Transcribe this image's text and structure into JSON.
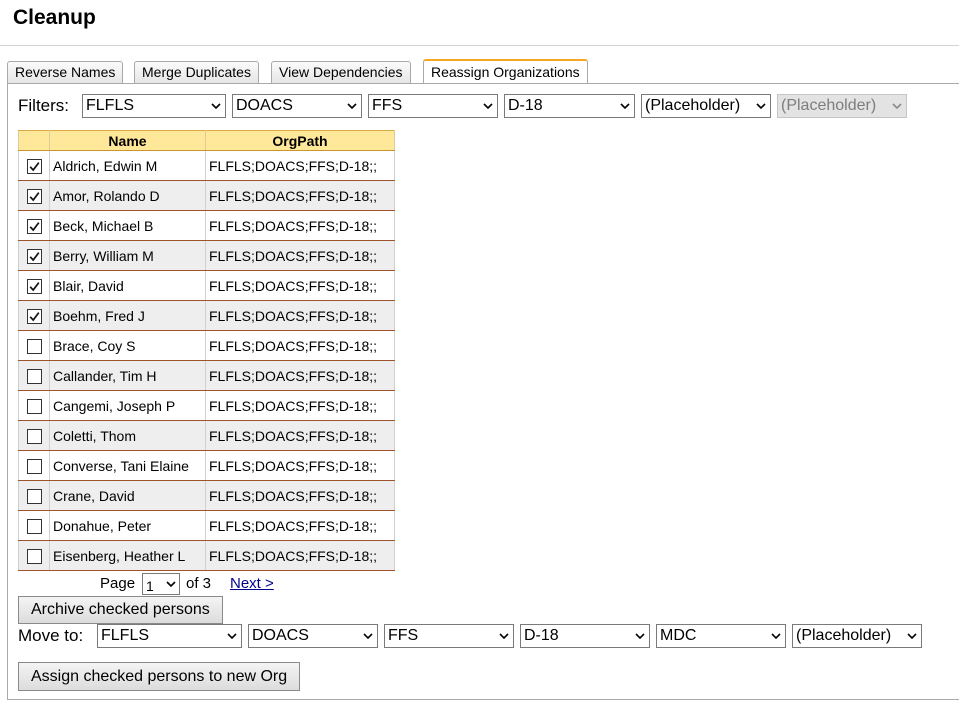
{
  "page": {
    "title": "Cleanup"
  },
  "tabs": [
    {
      "label": "Reverse Names"
    },
    {
      "label": "Merge Duplicates"
    },
    {
      "label": "View Dependencies"
    },
    {
      "label": "Reassign Organizations",
      "active": true
    }
  ],
  "filters": {
    "label": "Filters:",
    "selects": [
      {
        "value": "FLFLS"
      },
      {
        "value": "DOACS"
      },
      {
        "value": "FFS"
      },
      {
        "value": "D-18"
      },
      {
        "value": "(Placeholder)"
      },
      {
        "value": "(Placeholder)",
        "disabled": true
      }
    ]
  },
  "grid": {
    "columns": {
      "checkbox": "",
      "name": "Name",
      "orgpath": "OrgPath"
    },
    "rows": [
      {
        "name": "Aldrich, Edwin M",
        "orgpath": "FLFLS;DOACS;FFS;D-18;;",
        "checked": true
      },
      {
        "name": "Amor, Rolando D",
        "orgpath": "FLFLS;DOACS;FFS;D-18;;",
        "checked": true
      },
      {
        "name": "Beck, Michael B",
        "orgpath": "FLFLS;DOACS;FFS;D-18;;",
        "checked": true
      },
      {
        "name": "Berry, William M",
        "orgpath": "FLFLS;DOACS;FFS;D-18;;",
        "checked": true
      },
      {
        "name": "Blair, David",
        "orgpath": "FLFLS;DOACS;FFS;D-18;;",
        "checked": true
      },
      {
        "name": "Boehm, Fred J",
        "orgpath": "FLFLS;DOACS;FFS;D-18;;",
        "checked": true
      },
      {
        "name": "Brace, Coy S",
        "orgpath": "FLFLS;DOACS;FFS;D-18;;",
        "checked": false
      },
      {
        "name": "Callander, Tim H",
        "orgpath": "FLFLS;DOACS;FFS;D-18;;",
        "checked": false
      },
      {
        "name": "Cangemi, Joseph P",
        "orgpath": "FLFLS;DOACS;FFS;D-18;;",
        "checked": false
      },
      {
        "name": "Coletti, Thom",
        "orgpath": "FLFLS;DOACS;FFS;D-18;;",
        "checked": false
      },
      {
        "name": "Converse, Tani Elaine",
        "orgpath": "FLFLS;DOACS;FFS;D-18;;",
        "checked": false
      },
      {
        "name": "Crane, David",
        "orgpath": "FLFLS;DOACS;FFS;D-18;;",
        "checked": false
      },
      {
        "name": "Donahue, Peter",
        "orgpath": "FLFLS;DOACS;FFS;D-18;;",
        "checked": false
      },
      {
        "name": "Eisenberg, Heather L",
        "orgpath": "FLFLS;DOACS;FFS;D-18;;",
        "checked": false
      }
    ]
  },
  "pager": {
    "page_label": "Page",
    "current_page": "1",
    "of_label": "of 3",
    "next_label": "Next >"
  },
  "actions": {
    "archive_label": "Archive checked persons",
    "assign_label": "Assign checked persons to new Org"
  },
  "move_to": {
    "label": "Move to:",
    "selects": [
      {
        "value": "FLFLS"
      },
      {
        "value": "DOACS"
      },
      {
        "value": "FFS"
      },
      {
        "value": "D-18"
      },
      {
        "value": "MDC"
      },
      {
        "value": "(Placeholder)"
      }
    ]
  },
  "icons": {
    "checkmark": "checkmark-icon",
    "dropdown": "chevron-down-icon"
  }
}
